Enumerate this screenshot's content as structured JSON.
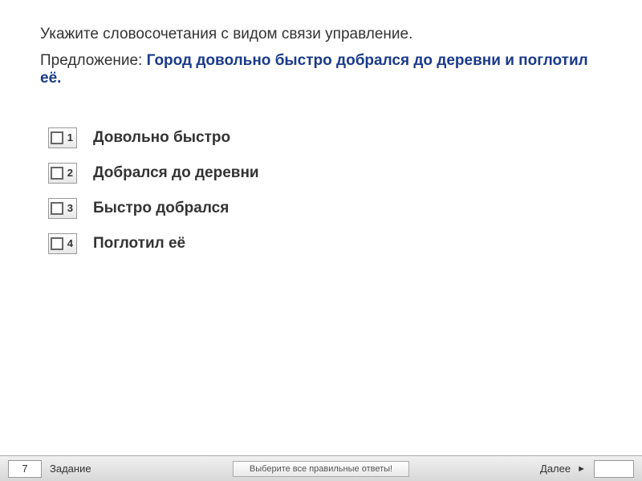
{
  "question": {
    "instruction": "Укажите словосочетания с видом связи управление.",
    "sentence_label": "Предложение: ",
    "sentence_text": "Город довольно быстро добрался до деревни и поглотил её."
  },
  "options": [
    {
      "number": "1",
      "text": "Довольно быстро"
    },
    {
      "number": "2",
      "text": "Добрался до деревни"
    },
    {
      "number": "3",
      "text": "Быстро добрался"
    },
    {
      "number": "4",
      "text": "Поглотил её"
    }
  ],
  "footer": {
    "task_number": "7",
    "task_label": "Задание",
    "instruction": "Выберите все правильные ответы!",
    "next_label": "Далее",
    "next_arrow": "►"
  }
}
